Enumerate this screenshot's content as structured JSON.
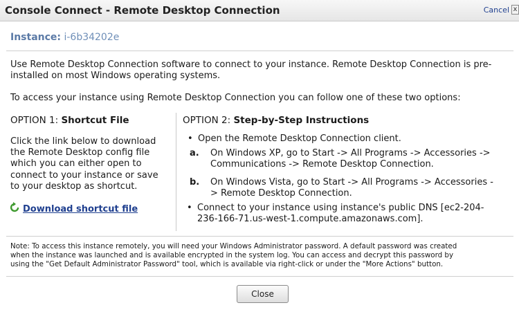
{
  "dialog": {
    "title": "Console Connect - Remote Desktop Connection",
    "cancel_label": "Cancel",
    "close_x": "x"
  },
  "instance": {
    "label": "Instance:",
    "id": "i-6b34202e"
  },
  "intro": {
    "line1": "Use Remote Desktop Connection software to connect to your instance. Remote Desktop Connection is pre-",
    "line2": "installed on most Windows operating systems.",
    "options_text": "To access your instance using Remote Desktop Connection you can follow one of these two options:"
  },
  "option1": {
    "prefix": "OPTION 1:",
    "title": "Shortcut File",
    "lines": [
      "Click the link below to download",
      "the Remote Desktop config file",
      "which you can either open to",
      "connect to your instance or save",
      "to your desktop as shortcut."
    ],
    "download_label": "Download shortcut file"
  },
  "option2": {
    "prefix": "OPTION 2:",
    "title": "Step-by-Step Instructions",
    "bullet": "•",
    "step1": "Open the Remote Desktop Connection client.",
    "a_letter": "a.",
    "a_line1": "On Windows XP, go to Start -> All Programs -> Accessories ->",
    "a_line2": "Communications -> Remote Desktop Connection.",
    "b_letter": "b.",
    "b_line1": "On Windows Vista, go to Start -> All Programs -> Accessories -",
    "b_line2": "> Remote Desktop Connection.",
    "step2_line1": "Connect to your instance using instance's public DNS [ec2-204-",
    "step2_line2": "236-166-71.us-west-1.compute.amazonaws.com]."
  },
  "note": {
    "line1": "Note: To access this instance remotely, you will need your Windows Administrator password. A default password was created",
    "line2": "when the instance was launched and is available encrypted in the system log. You can access and decrypt this password by",
    "line3": "using the \"Get Default Administrator Password\" tool, which is available via right-click or under the \"More Actions\" button."
  },
  "footer": {
    "close_label": "Close"
  },
  "colors": {
    "link": "#1f3f8f",
    "instance_label": "#5b7aa6",
    "download_icon": "#3f9a2f"
  }
}
